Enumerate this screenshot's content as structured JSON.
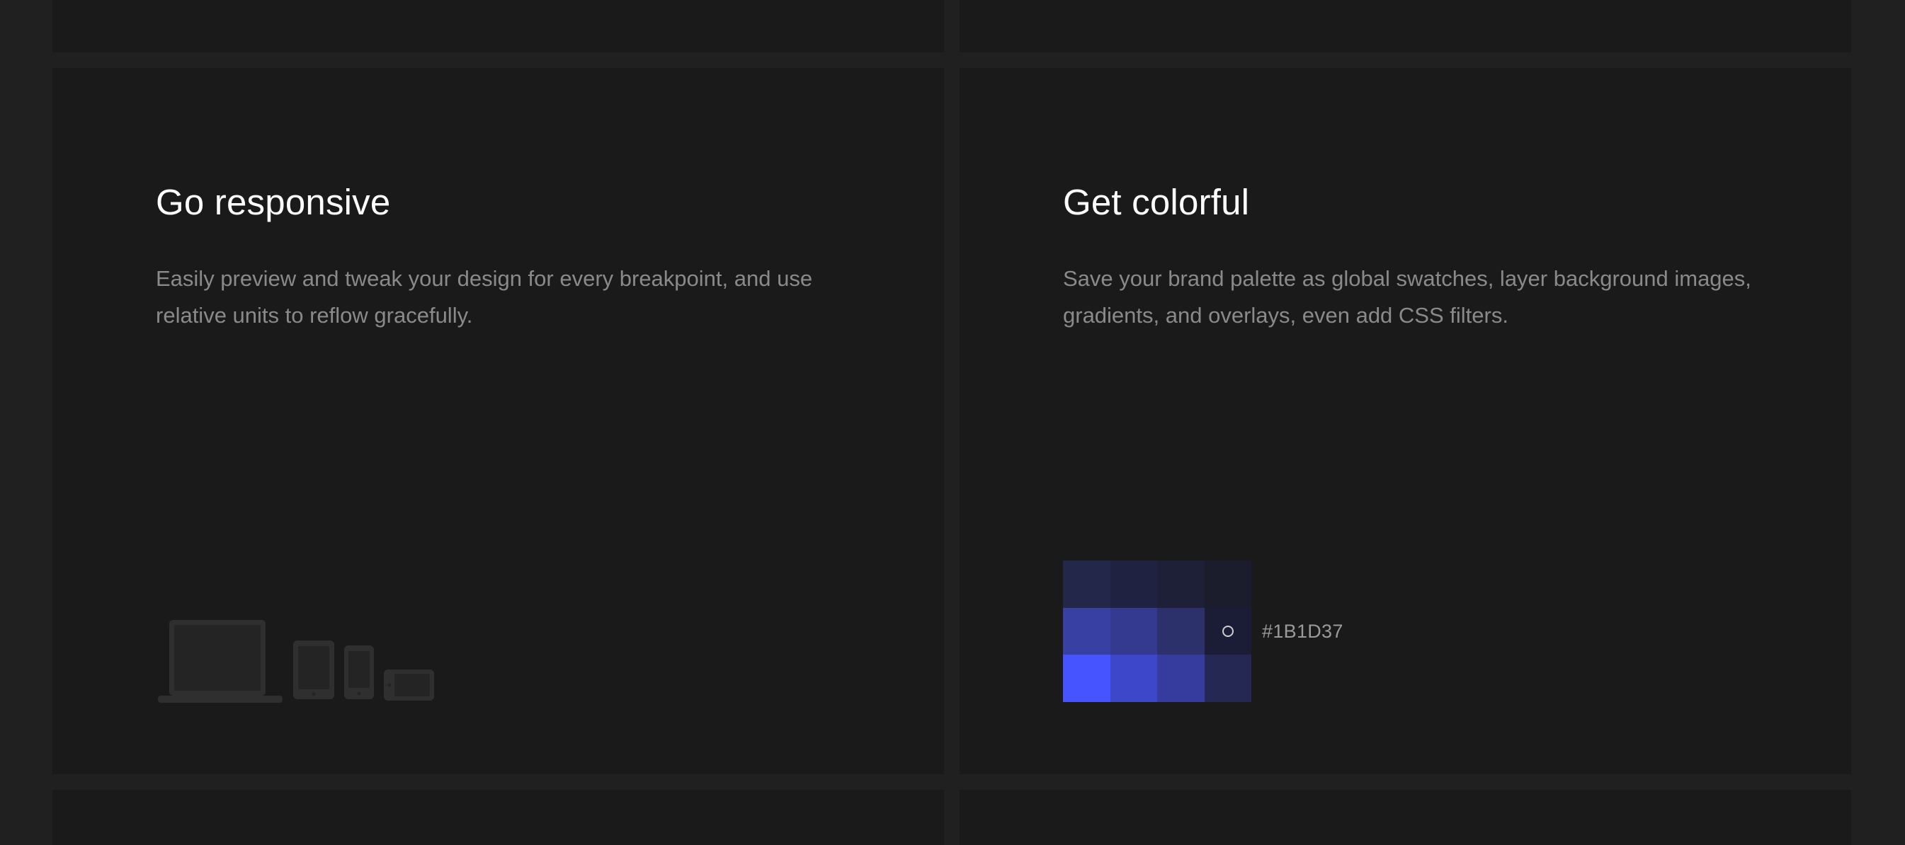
{
  "features": {
    "responsive": {
      "title": "Go responsive",
      "description": "Easily preview and tweak your design for every breakpoint, and use relative units to reflow gracefully.",
      "device_icons": [
        "laptop-icon",
        "tablet-icon",
        "phone-icon",
        "phone-landscape-icon"
      ]
    },
    "colorful": {
      "title": "Get colorful",
      "description": "Save your brand palette as global swatches, layer background images, gradients, and overlays, even add CSS filters.",
      "selected_hex": "#1B1D37",
      "swatches": [
        [
          "#23274a",
          "#1f2240",
          "#1e2038",
          "#1b1d2c"
        ],
        [
          "#3840a4",
          "#333a8f",
          "#2c316c",
          "#1b1d37"
        ],
        [
          "#4554ff",
          "#3c47c9",
          "#353c9e",
          "#242852"
        ]
      ]
    }
  }
}
